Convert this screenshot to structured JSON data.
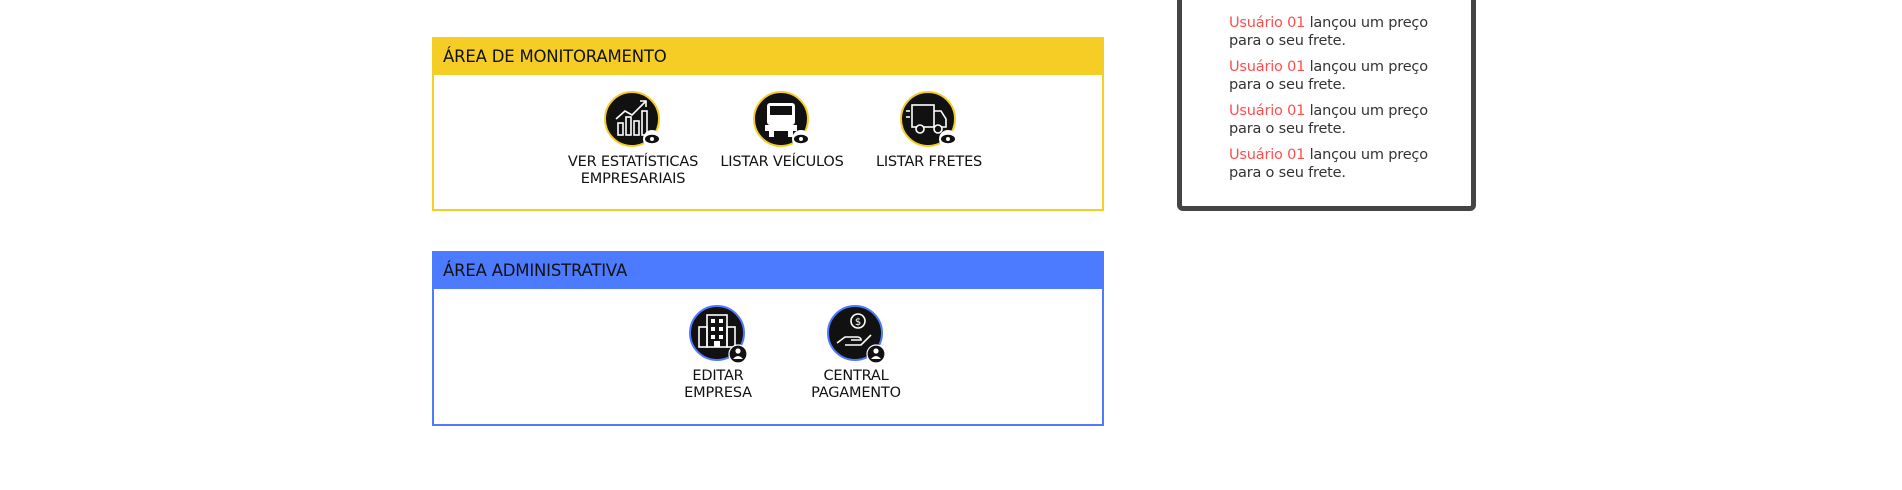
{
  "monitoring": {
    "title": "ÁREA DE MONITORAMENTO",
    "accent": "#f6cd25",
    "tiles": [
      {
        "label": "VER ESTATÍSTICAS\nEMPRESARIAIS",
        "icon": "statistics-chart-icon"
      },
      {
        "label": "LISTAR VEÍCULOS",
        "icon": "truck-icon"
      },
      {
        "label": "LISTAR FRETES",
        "icon": "delivery-truck-icon"
      }
    ]
  },
  "administrative": {
    "title": "ÁREA ADMINISTRATIVA",
    "accent": "#4d7bff",
    "tiles": [
      {
        "label": "EDITAR\nEMPRESA",
        "icon": "building-icon"
      },
      {
        "label": "CENTRAL\nPAGAMENTO",
        "icon": "payment-hand-icon"
      }
    ]
  },
  "feed": {
    "items": [
      {
        "user": "Usuário 01",
        "text": " lançou um preço para o seu frete."
      },
      {
        "user": "Usuário 01",
        "text": " lançou um preço para o seu frete."
      },
      {
        "user": "Usuário 01",
        "text": " lançou um preço para o seu frete."
      },
      {
        "user": "Usuário 01",
        "text": " lançou um preço para o seu frete."
      }
    ],
    "user_color": "#ff4d4d"
  }
}
